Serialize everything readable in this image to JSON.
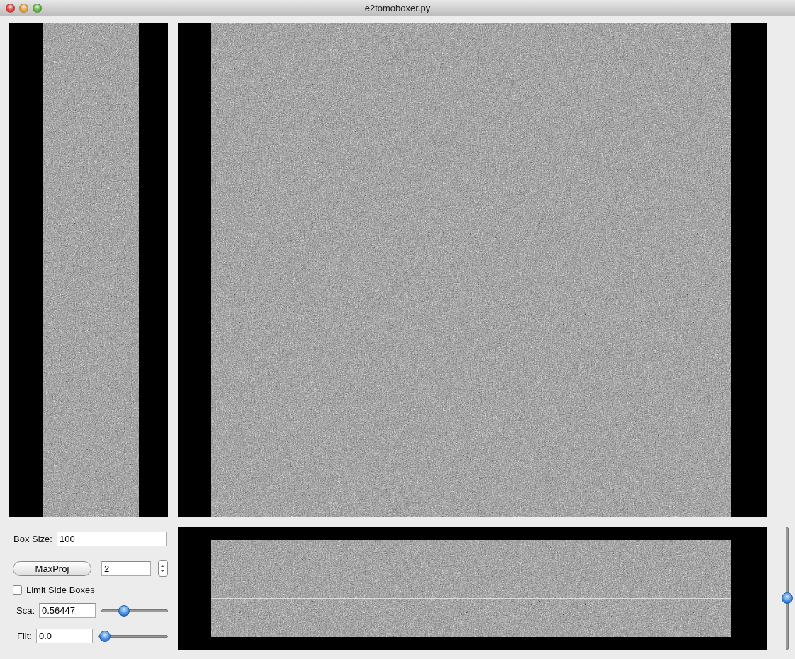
{
  "window": {
    "title": "e2tomoboxer.py"
  },
  "controls": {
    "box_size": {
      "label": "Box Size:",
      "value": "100"
    },
    "maxproj": {
      "label": "MaxProj",
      "value": "2"
    },
    "limit_side_boxes": {
      "label": "Limit Side Boxes",
      "checked": false
    },
    "scale": {
      "label": "Sca:",
      "value": "0.56447",
      "level": 0.3
    },
    "filter": {
      "label": "Filt:",
      "value": "0.0",
      "level": 0.0
    }
  },
  "slice_slider": {
    "level": 0.42
  }
}
